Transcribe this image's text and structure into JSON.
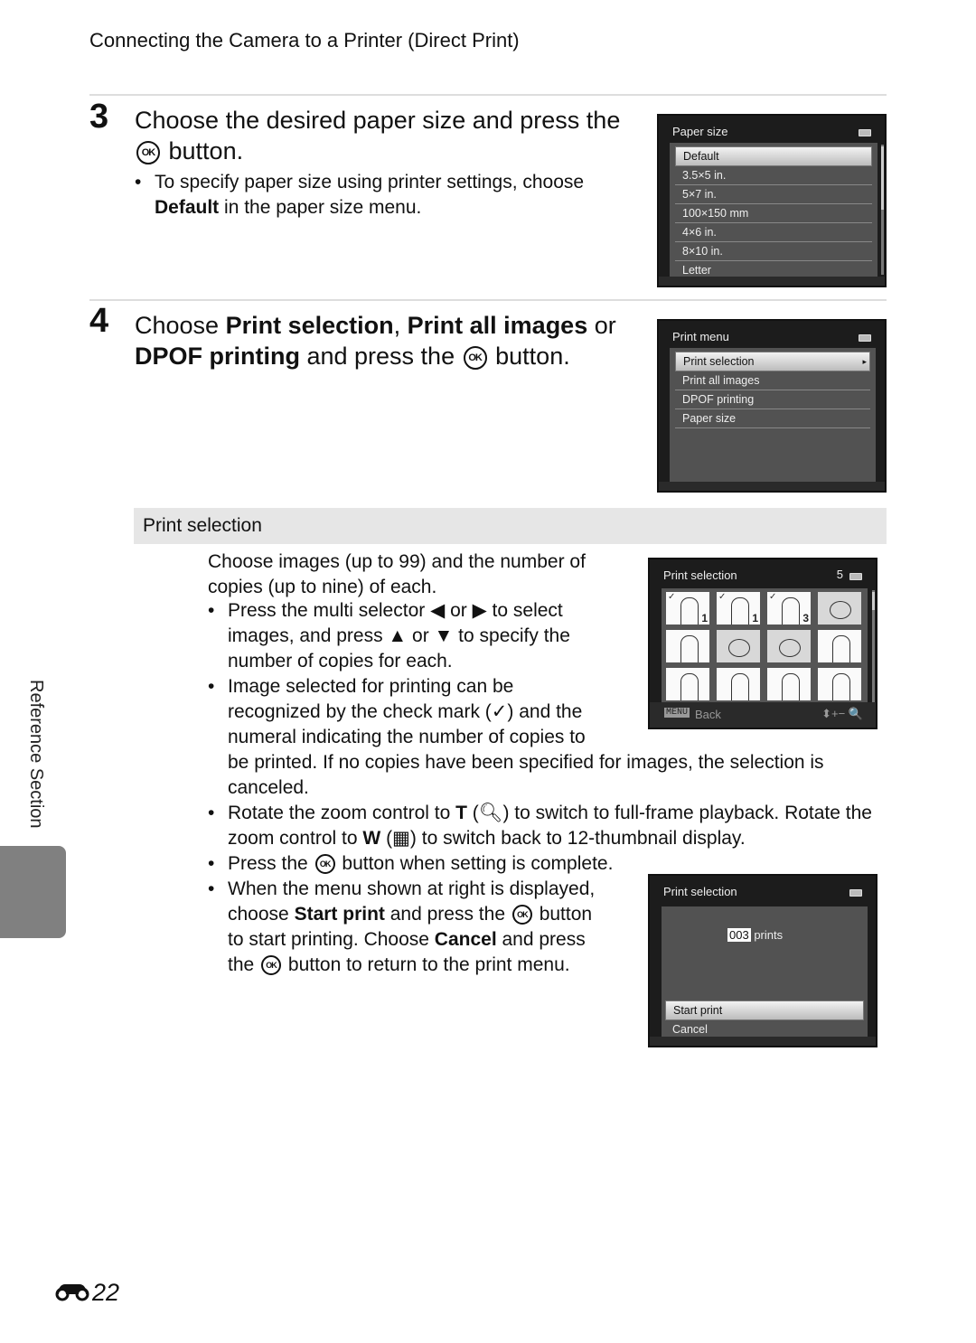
{
  "running_head": "Connecting the Camera to a Printer (Direct Print)",
  "steps": [
    {
      "number": "3",
      "title_a": "Choose the desired paper size and press the",
      "title_b": "button.",
      "bullet_a": "To specify paper size using printer settings, choose",
      "bullet_bold": "Default",
      "bullet_b": "in the paper size menu."
    },
    {
      "number": "4",
      "t1": "Choose ",
      "t2": "Print selection",
      "t3": ", ",
      "t4": "Print all images",
      "t5": " or",
      "t6": "DPOF printing",
      "t7": " and press the",
      "t8": "button."
    }
  ],
  "screens": {
    "paper_size": {
      "title": "Paper size",
      "items": [
        "Default",
        "3.5×5 in.",
        "5×7 in.",
        "100×150 mm",
        "4×6 in.",
        "8×10 in.",
        "Letter"
      ],
      "selected": "Default"
    },
    "print_menu": {
      "title": "Print menu",
      "items": [
        "Print selection",
        "Print all images",
        "DPOF printing",
        "Paper size"
      ],
      "selected": "Print selection",
      "arrow": "▸"
    },
    "print_selection_grid": {
      "title": "Print selection",
      "count": "5",
      "thumbnails": [
        {
          "type": "portrait",
          "checked": true,
          "copies": "1"
        },
        {
          "type": "portrait",
          "checked": true,
          "copies": "1"
        },
        {
          "type": "portrait",
          "checked": true,
          "copies": "3"
        },
        {
          "type": "flower",
          "checked": false,
          "copies": ""
        },
        {
          "type": "portrait",
          "checked": false,
          "copies": ""
        },
        {
          "type": "flower",
          "checked": false,
          "copies": ""
        },
        {
          "type": "flower",
          "checked": false,
          "copies": ""
        },
        {
          "type": "portrait",
          "checked": false,
          "copies": ""
        },
        {
          "type": "portrait",
          "checked": false,
          "copies": ""
        },
        {
          "type": "portrait",
          "checked": false,
          "copies": ""
        },
        {
          "type": "portrait",
          "checked": false,
          "copies": ""
        },
        {
          "type": "portrait",
          "checked": false,
          "copies": ""
        }
      ],
      "menu_key": "MENU",
      "back_label": "Back",
      "footer_icons": "⬍+− 🔍"
    },
    "print_confirm": {
      "title": "Print selection",
      "count_value": "003",
      "count_label": "prints",
      "items": [
        "Start print",
        "Cancel"
      ],
      "selected": "Start print"
    }
  },
  "section": {
    "heading": "Print selection",
    "intro_1": "Choose images (up to 99) and the number of",
    "intro_2": "copies (up to nine) of each.",
    "b1_1": "Press the multi selector ◀ or ▶ to select",
    "b1_2": "images, and press ▲ or ▼ to specify the",
    "b1_3": "number of copies for each.",
    "b2_1": "Image selected for printing can be",
    "b2_2": "recognized by the check mark (✓) and the",
    "b2_3": "numeral indicating the number of copies to",
    "b2_4": "be printed. If no copies have been specified for images, the selection is",
    "b2_5": "canceled.",
    "b3_a": "Rotate the zoom control to ",
    "b3_T": "T",
    "b3_b": " (🔍︎) to switch to full-frame playback. Rotate the",
    "b3_c": "zoom control to ",
    "b3_W": "W",
    "b3_d": " (▦) to switch back to 12-thumbnail display.",
    "b4_a": "Press the",
    "b4_b": "button when setting is complete.",
    "b5_1": "When the menu shown at right is displayed,",
    "b5_2a": "choose ",
    "b5_2b": "Start print",
    "b5_2c": " and press the",
    "b5_2d": "button",
    "b5_3a": "to start printing. Choose ",
    "b5_3b": "Cancel",
    "b5_3c": " and press",
    "b5_4a": "the",
    "b5_4b": "button to return to the print menu."
  },
  "side_tab": "Reference Section",
  "ok_glyph": "OK",
  "page_number": "22"
}
